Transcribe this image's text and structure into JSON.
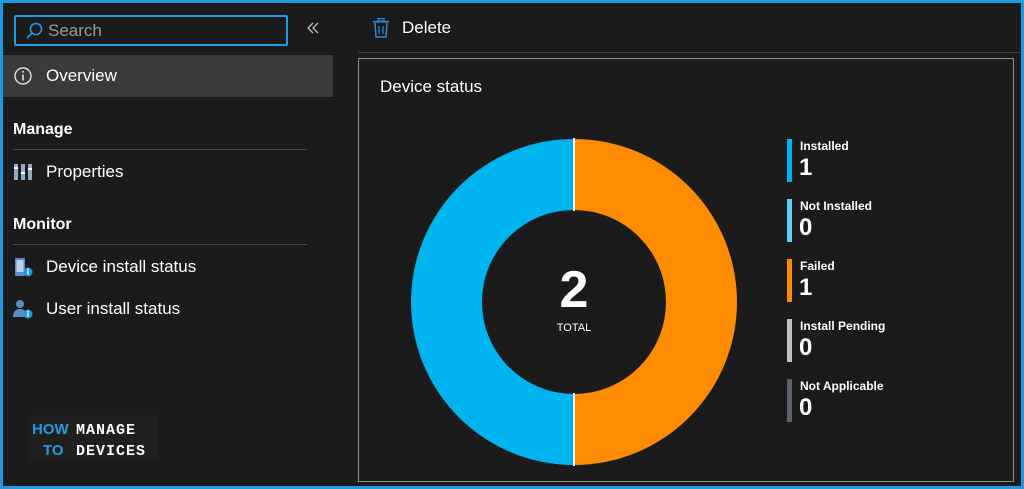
{
  "search": {
    "placeholder": "Search",
    "value": ""
  },
  "sidebar": {
    "overview_label": "Overview",
    "sections": [
      {
        "title": "Manage",
        "items": [
          {
            "label": "Properties",
            "icon": "properties-icon"
          }
        ]
      },
      {
        "title": "Monitor",
        "items": [
          {
            "label": "Device install status",
            "icon": "device-status-icon"
          },
          {
            "label": "User install status",
            "icon": "user-status-icon"
          }
        ]
      }
    ]
  },
  "logo": {
    "line1a": "HOW",
    "line1b": "MANAGE",
    "line2a": "TO",
    "line2b": "DEVICES"
  },
  "toolbar": {
    "delete_label": "Delete"
  },
  "card": {
    "title": "Device status",
    "total_value": "2",
    "total_label": "TOTAL",
    "legend": [
      {
        "name": "Installed",
        "value": "1",
        "color": "#00b4f0"
      },
      {
        "name": "Not Installed",
        "value": "0",
        "color": "#5cd0f5"
      },
      {
        "name": "Failed",
        "value": "1",
        "color": "#ff8c00"
      },
      {
        "name": "Install Pending",
        "value": "0",
        "color": "#bfbfbf"
      },
      {
        "name": "Not Applicable",
        "value": "0",
        "color": "#5a6170"
      }
    ]
  },
  "chart_data": {
    "type": "pie",
    "categories": [
      "Installed",
      "Not Installed",
      "Failed",
      "Install Pending",
      "Not Applicable"
    ],
    "values": [
      1,
      0,
      1,
      0,
      0
    ],
    "colors": [
      "#00b4f0",
      "#5cd0f5",
      "#ff8c00",
      "#bfbfbf",
      "#5a6170"
    ],
    "title": "Device status",
    "legend": "right"
  },
  "colors": {
    "accent": "#1e9be0",
    "background": "#1b1b1b",
    "selected": "#3a3a3a"
  }
}
